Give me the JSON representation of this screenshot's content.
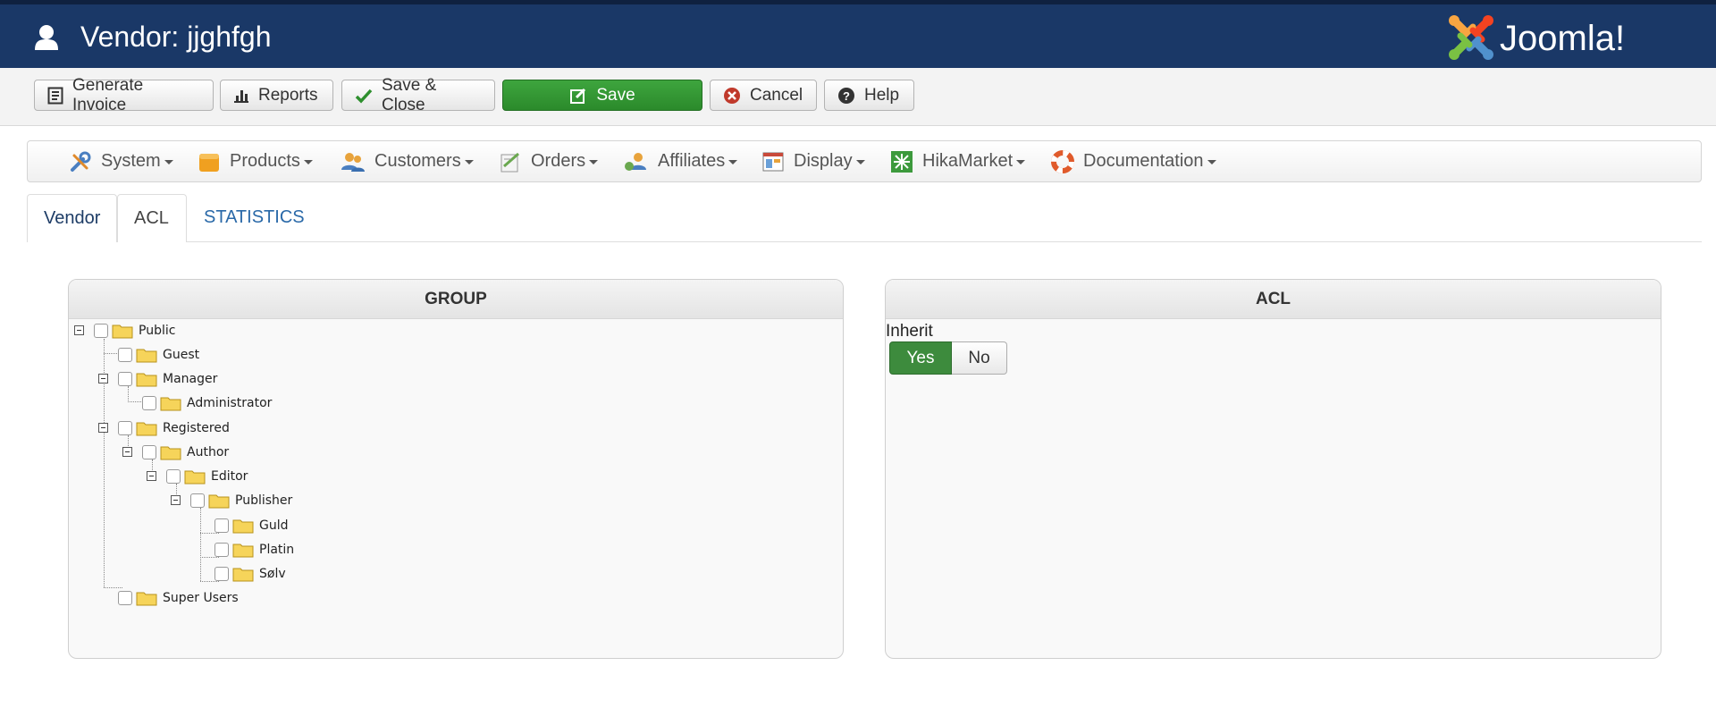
{
  "header": {
    "title": "Vendor: jjghfgh",
    "logo_text": "Joomla!"
  },
  "toolbar": {
    "generate_invoice": "Generate Invoice",
    "reports": "Reports",
    "save_close": "Save & Close",
    "save": "Save",
    "cancel": "Cancel",
    "help": "Help"
  },
  "menu": {
    "items": [
      {
        "label": "System",
        "icon": "wrench-screwdriver-icon"
      },
      {
        "label": "Products",
        "icon": "products-box-icon"
      },
      {
        "label": "Customers",
        "icon": "customers-icon"
      },
      {
        "label": "Orders",
        "icon": "orders-icon"
      },
      {
        "label": "Affiliates",
        "icon": "affiliates-icon"
      },
      {
        "label": "Display",
        "icon": "display-icon"
      },
      {
        "label": "HikaMarket",
        "icon": "hikamarket-icon"
      },
      {
        "label": "Documentation",
        "icon": "lifebuoy-icon"
      }
    ]
  },
  "tabs": [
    "Vendor",
    "ACL",
    "STATISTICS"
  ],
  "group_panel": {
    "title": "GROUP",
    "tree": [
      "Public",
      "Guest",
      "Manager",
      "Administrator",
      "Registered",
      "Author",
      "Editor",
      "Publisher",
      "Guld",
      "Platin",
      "Sølv",
      "Super Users"
    ]
  },
  "acl_panel": {
    "title": "ACL",
    "inherit_label": "Inherit",
    "yes": "Yes",
    "no": "No",
    "selected": "Yes"
  },
  "colors": {
    "header_bg": "#1a3867",
    "save_green": "#2e8f2e",
    "link_blue": "#2a69a8"
  }
}
